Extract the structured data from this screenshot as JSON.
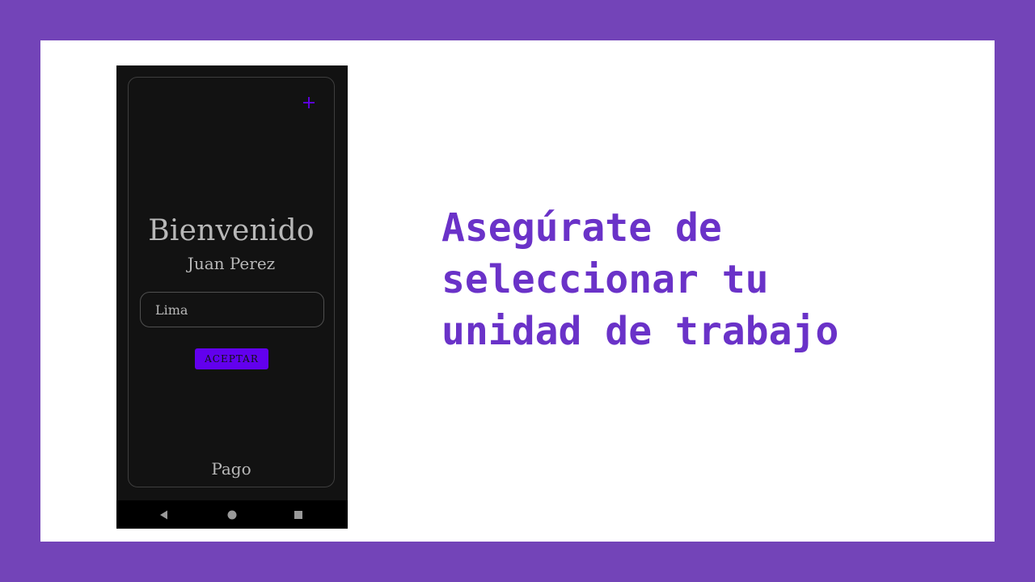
{
  "phone": {
    "welcome": "Bienvenido",
    "username": "Juan Perez",
    "unit_field": {
      "value": "Lima"
    },
    "accept_label": "ACEPTAR",
    "footer_label": "Pago",
    "icons": {
      "add": "plus-icon",
      "back": "back-triangle-icon",
      "home": "home-circle-icon",
      "recents": "recents-square-icon"
    }
  },
  "headline": "Asegúrate de\nseleccionar tu\nunidad de trabajo",
  "colors": {
    "frame": "#7344b8",
    "accent": "#6200ee",
    "headline": "#6a32c8",
    "phone_bg": "#121212"
  }
}
